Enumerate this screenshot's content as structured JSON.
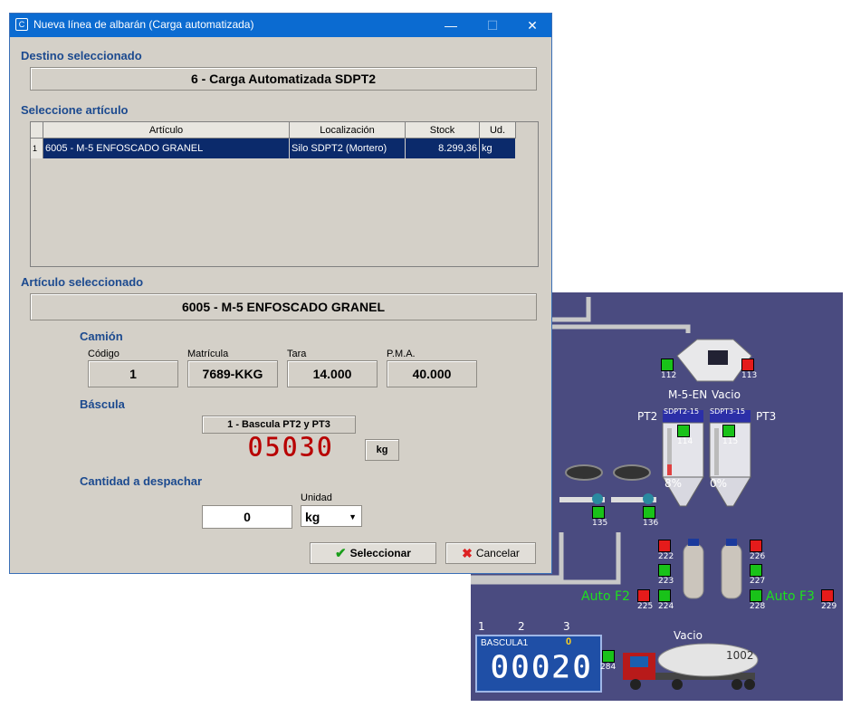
{
  "window": {
    "title": "Nueva línea de albarán (Carga automatizada)",
    "controls": {
      "minimize": "—",
      "maximize": "☐",
      "close": "✕"
    }
  },
  "destino": {
    "label": "Destino seleccionado",
    "value": "6 - Carga Automatizada SDPT2"
  },
  "articulo_grid": {
    "label": "Seleccione artículo",
    "columns": [
      "Artículo",
      "Localización",
      "Stock",
      "Ud."
    ],
    "rows": [
      {
        "row_num": "1",
        "articulo": "6005 - M-5 ENFOSCADO GRANEL",
        "localizacion": "Silo SDPT2 (Mortero)",
        "stock": "8.299,36",
        "ud": "kg"
      }
    ]
  },
  "articulo_seleccionado": {
    "label": "Artículo seleccionado",
    "value": "6005 - M-5 ENFOSCADO GRANEL"
  },
  "camion": {
    "label": "Camión",
    "codigo_label": "Código",
    "codigo": "1",
    "matricula_label": "Matrícula",
    "matricula": "7689-KKG",
    "tara_label": "Tara",
    "tara": "14.000",
    "pma_label": "P.M.A.",
    "pma": "40.000"
  },
  "bascula": {
    "label": "Báscula",
    "name": "1 - Bascula PT2 y PT3",
    "reading": "05030",
    "unit": "kg"
  },
  "cantidad": {
    "label": "Cantidad a despachar",
    "value": "0",
    "unidad_label": "Unidad",
    "unidad": "kg"
  },
  "buttons": {
    "select": "Seleccionar",
    "cancel": "Cancelar"
  },
  "colors": {
    "accent": "#0b6bd1",
    "section": "#1c4a8f",
    "scada_bg": "#4a4b80",
    "selected_row": "#0b2a6b"
  },
  "scada": {
    "labels": {
      "m5": "M-5-EN",
      "vacio_top": "Vacio",
      "pt2": "PT2",
      "pt3": "PT3",
      "silo1": "SDPT2-15",
      "silo2": "SDPT3-15",
      "pct1": "8%",
      "pct2": "0%",
      "auto_f2": "Auto F2",
      "auto_f3": "Auto F3",
      "vacio_truck": "Vacio",
      "truck_num": "1002",
      "scale_name": "BASCULA1",
      "scale_zero": "0",
      "scale_value": "00020",
      "tab1": "1",
      "tab2": "2",
      "tab3": "3"
    },
    "tags": [
      "112",
      "113",
      "114",
      "115",
      "135",
      "136",
      "222",
      "223",
      "224",
      "225",
      "226",
      "227",
      "228",
      "229",
      "284"
    ]
  }
}
